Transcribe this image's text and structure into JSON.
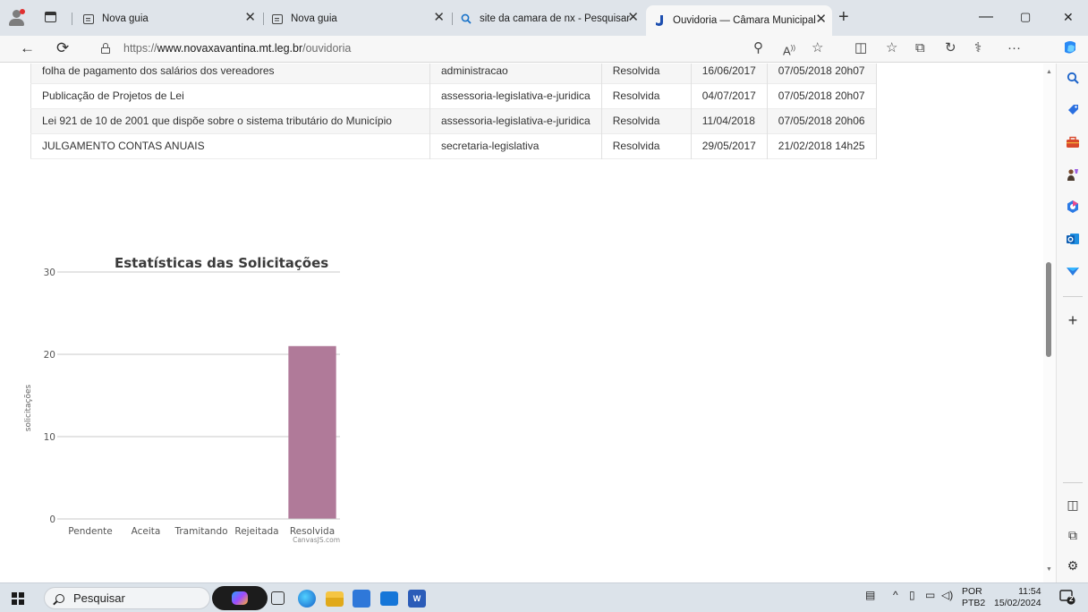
{
  "browser": {
    "tabs": [
      {
        "label": "Nova guia",
        "active": false
      },
      {
        "label": "Nova guia",
        "active": false
      },
      {
        "label": "site da camara de nx - Pesquisar",
        "active": false
      },
      {
        "label": "Ouvidoria — Câmara Municipal d",
        "active": true
      }
    ],
    "address": {
      "prefix": "https://",
      "host": "www.novaxavantina.mt.leg.br",
      "path": "/ouvidoria"
    },
    "new_tab_glyph": "+",
    "window_controls": {
      "minimize": "—",
      "restore": "▢",
      "close": "✕"
    }
  },
  "table": {
    "rows": [
      {
        "assunto": "folha de pagamento dos salários dos vereadores",
        "setor": "administracao",
        "status": "Resolvida",
        "data": "16/06/2017",
        "atualizado": "07/05/2018 20h07"
      },
      {
        "assunto": "Publicação de Projetos de Lei",
        "setor": "assessoria-legislativa-e-juridica",
        "status": "Resolvida",
        "data": "04/07/2017",
        "atualizado": "07/05/2018 20h07"
      },
      {
        "assunto": "Lei 921 de 10 de 2001 que dispõe sobre o sistema tributário do Município",
        "setor": "assessoria-legislativa-e-juridica",
        "status": "Resolvida",
        "data": "11/04/2018",
        "atualizado": "07/05/2018 20h06"
      },
      {
        "assunto": "JULGAMENTO CONTAS ANUAIS",
        "setor": "secretaria-legislativa",
        "status": "Resolvida",
        "data": "29/05/2017",
        "atualizado": "21/02/2018 14h25"
      }
    ]
  },
  "chart_data": {
    "type": "bar",
    "title": "Estatísticas das Solicitações",
    "ylabel": "solicitações",
    "xlabel": "",
    "categories": [
      "Pendente",
      "Aceita",
      "Tramitando",
      "Rejeitada",
      "Resolvida"
    ],
    "values": [
      0,
      0,
      0,
      0,
      21
    ],
    "ylim": [
      0,
      30
    ],
    "yticks": [
      0,
      10,
      20,
      30
    ],
    "grid": true,
    "bar_color": "#b07a99",
    "credit": "CanvasJS.com"
  },
  "taskbar": {
    "search_placeholder": "Pesquisar",
    "language": "POR",
    "keyboard": "PTB2",
    "time": "11:54",
    "date": "15/02/2024",
    "notification_count": "2"
  },
  "colors": {
    "tabstrip": "#dfe4ea",
    "taskbar": "#dce3ea",
    "bar": "#b07a99"
  }
}
